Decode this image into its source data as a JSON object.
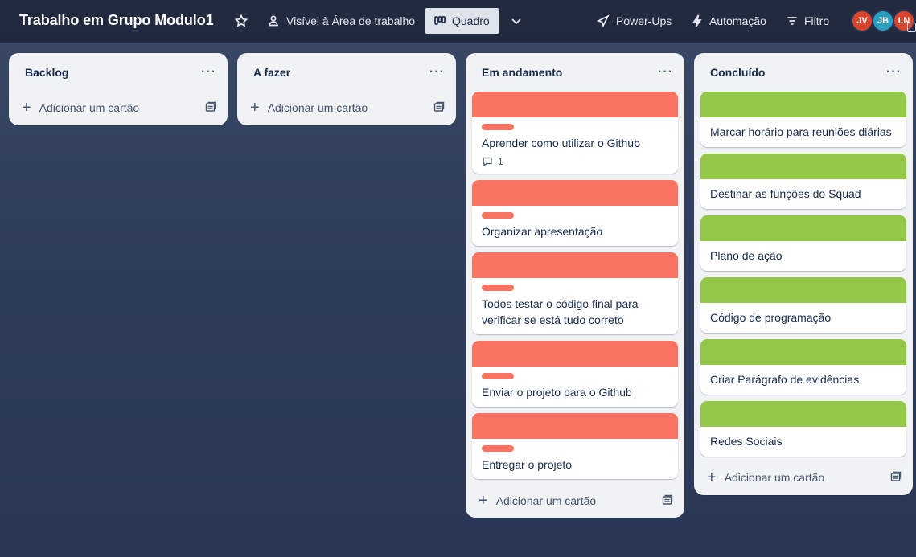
{
  "header": {
    "board_title": "Trabalho em Grupo Modulo1",
    "star_icon": "star-icon",
    "visibility_label": "Visível à Área de trabalho",
    "view_label": "Quadro",
    "powerups_label": "Power-Ups",
    "automation_label": "Automação",
    "filter_label": "Filtro",
    "members": [
      "JV",
      "JB",
      "LN"
    ]
  },
  "colors": {
    "red_cover": "#f87462",
    "green_cover": "#94c748",
    "avatar_red": "#d9452c",
    "avatar_blue": "#2a9fbf"
  },
  "lists": [
    {
      "title": "Backlog",
      "menu": "···",
      "add_label": "Adicionar um cartão",
      "cards": []
    },
    {
      "title": "A fazer",
      "menu": "···",
      "add_label": "Adicionar um cartão",
      "cards": []
    },
    {
      "title": "Em andamento",
      "menu": "···",
      "add_label": "Adicionar um cartão",
      "cards": [
        {
          "title": "Aprender como utilizar o Github",
          "comments": "1"
        },
        {
          "title": "Organizar apresentação"
        },
        {
          "title": "Todos testar o código final para verificar se está tudo correto"
        },
        {
          "title": "Enviar o projeto para o Github"
        },
        {
          "title": "Entregar o projeto"
        }
      ]
    },
    {
      "title": "Concluído",
      "menu": "···",
      "add_label": "Adicionar um cartão",
      "cards": [
        {
          "title": "Marcar horário para reuniões diárias"
        },
        {
          "title": "Destinar as funções do Squad"
        },
        {
          "title": "Plano de ação"
        },
        {
          "title": "Código de programação"
        },
        {
          "title": "Criar Parágrafo de evidências"
        },
        {
          "title": "Redes Sociais"
        }
      ]
    }
  ]
}
